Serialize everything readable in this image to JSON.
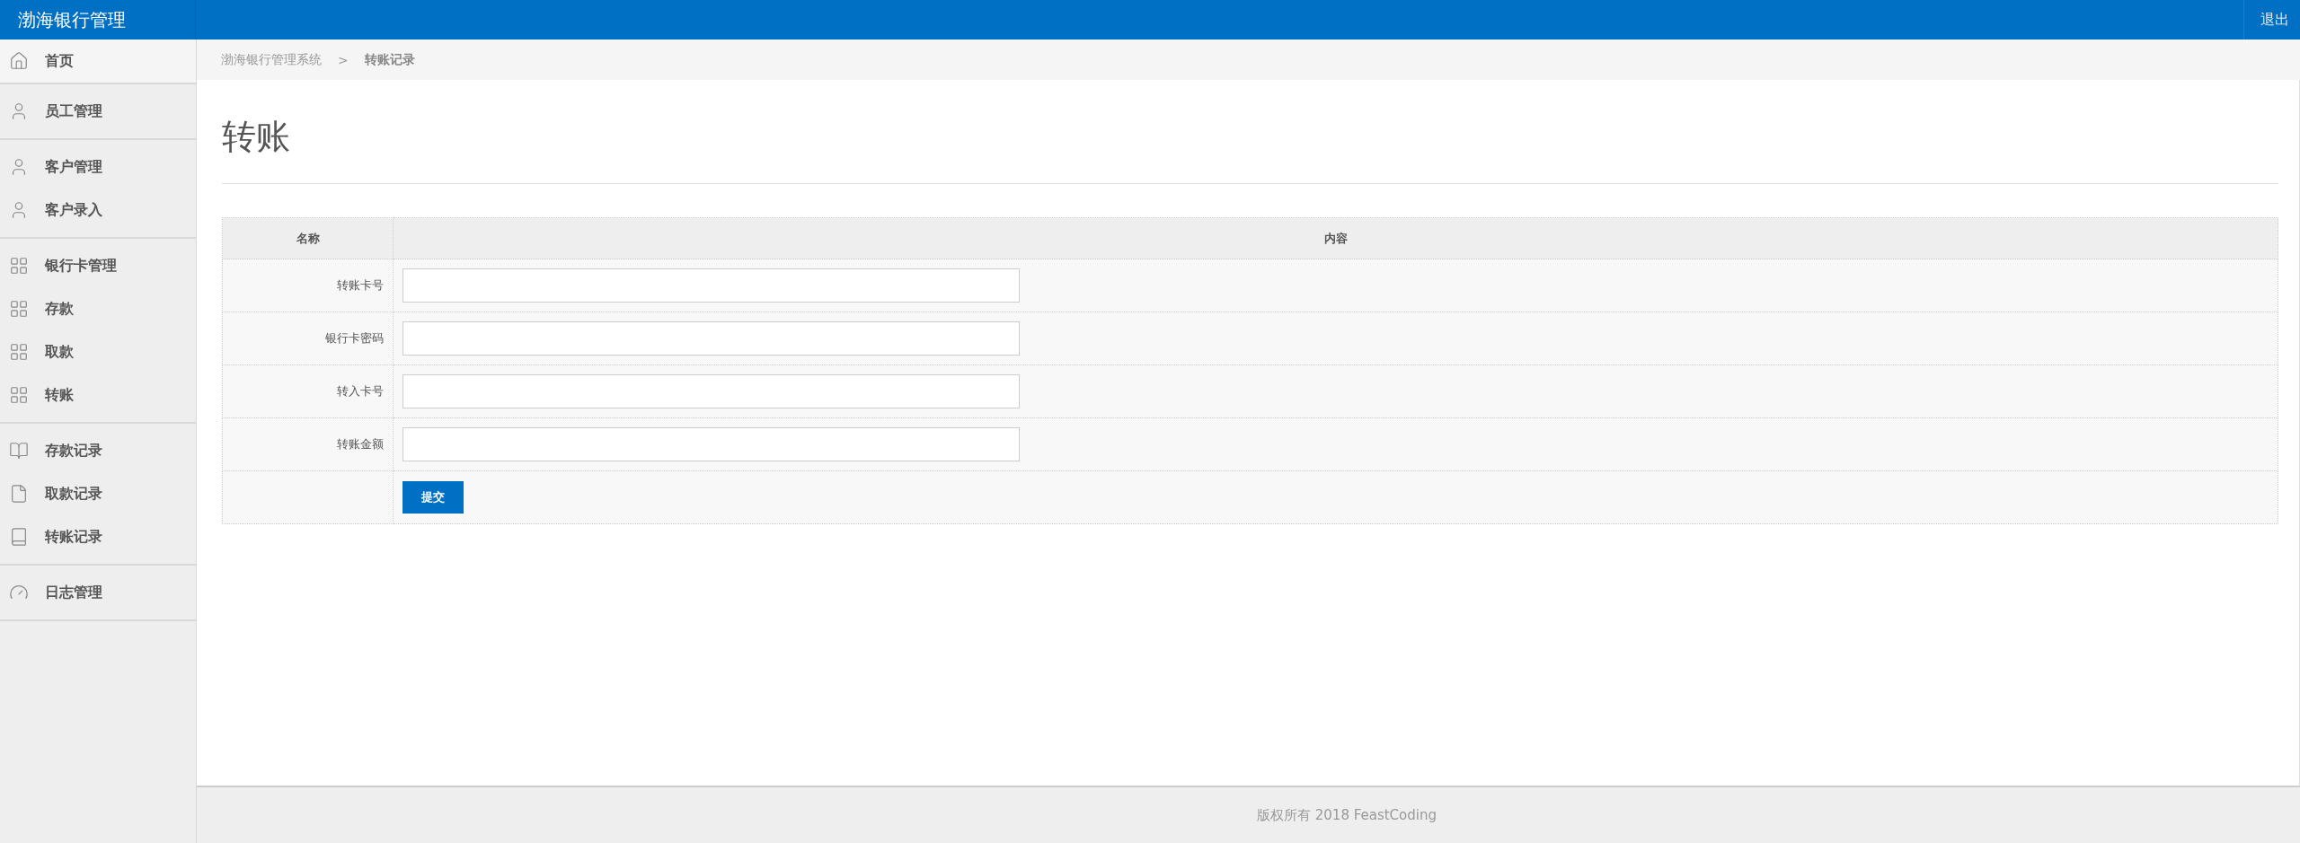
{
  "header": {
    "title": "渤海银行管理",
    "logout": "退出"
  },
  "sidebar": {
    "groups": [
      {
        "highlighted": true,
        "items": [
          {
            "label": "首页"
          }
        ]
      },
      {
        "highlighted": false,
        "items": [
          {
            "label": "员工管理"
          }
        ]
      },
      {
        "highlighted": false,
        "items": [
          {
            "label": "客户管理"
          },
          {
            "label": "客户录入"
          }
        ]
      },
      {
        "highlighted": false,
        "items": [
          {
            "label": "银行卡管理"
          },
          {
            "label": "存款"
          },
          {
            "label": "取款"
          },
          {
            "label": "转账"
          }
        ]
      },
      {
        "highlighted": false,
        "items": [
          {
            "label": "存款记录"
          },
          {
            "label": "取款记录"
          },
          {
            "label": "转账记录"
          }
        ]
      },
      {
        "highlighted": false,
        "items": [
          {
            "label": "日志管理"
          }
        ]
      }
    ]
  },
  "breadcrumb": [
    "渤海银行管理系统",
    "转账记录"
  ],
  "breadcrumb_separator": ">",
  "page_title": "转账",
  "form_table": {
    "columns": [
      "名称",
      "内容"
    ],
    "rows": [
      {
        "label": "转账卡号"
      },
      {
        "label": "银行卡密码"
      },
      {
        "label": "转入卡号"
      },
      {
        "label": "转账金额"
      }
    ],
    "submit": "提交"
  },
  "footer": "版权所有 2018 FeastCoding"
}
